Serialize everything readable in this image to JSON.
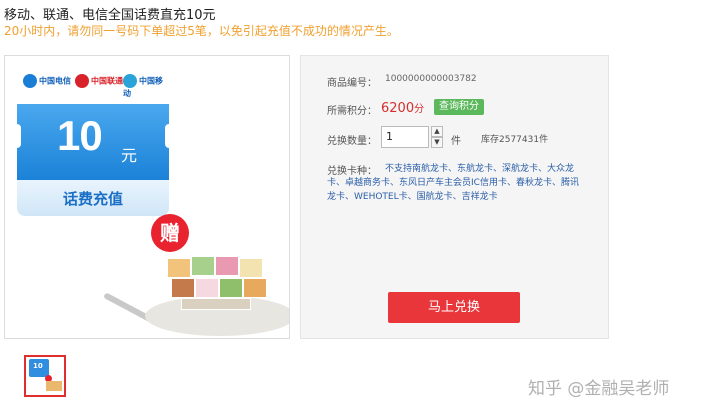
{
  "product": {
    "title": "移动、联通、电信全国话费直充10元",
    "notice": "20小时内，请勿同一号码下单超过5笔，以免引起充值不成功的情况产生。"
  },
  "image": {
    "amount": "10",
    "unit": "元",
    "card_label": "话费充值",
    "gift_label": "赠",
    "logos": [
      "中国电信",
      "中国联通",
      "中国移动"
    ],
    "thumb_amount": "10"
  },
  "info": {
    "code_label": "商品编号：",
    "code_value": "1000000000003782",
    "points_label": "所需积分：",
    "points_value": "6200",
    "points_unit": "分",
    "query_button": "查询积分",
    "qty_label": "兑换数量：",
    "qty_value": "1",
    "qty_unit": "件",
    "stock": "库存2577431件",
    "cards_label": "兑换卡种：",
    "cards_list": "不支持南航龙卡、东航龙卡、深航龙卡、大众龙卡、卓越商务卡、东风日产车主会员IC信用卡、春秋龙卡、腾讯龙卡、WEHOTEL卡、国航龙卡、吉祥龙卡",
    "exchange_button": "马上兑换"
  },
  "watermark": "知乎 @金融吴老师",
  "colors": {
    "accent_red": "#e8363a",
    "notice_orange": "#f0a030",
    "points_red": "#d52e2e",
    "query_green": "#5cb85c",
    "link_blue": "#2a5ea8"
  }
}
